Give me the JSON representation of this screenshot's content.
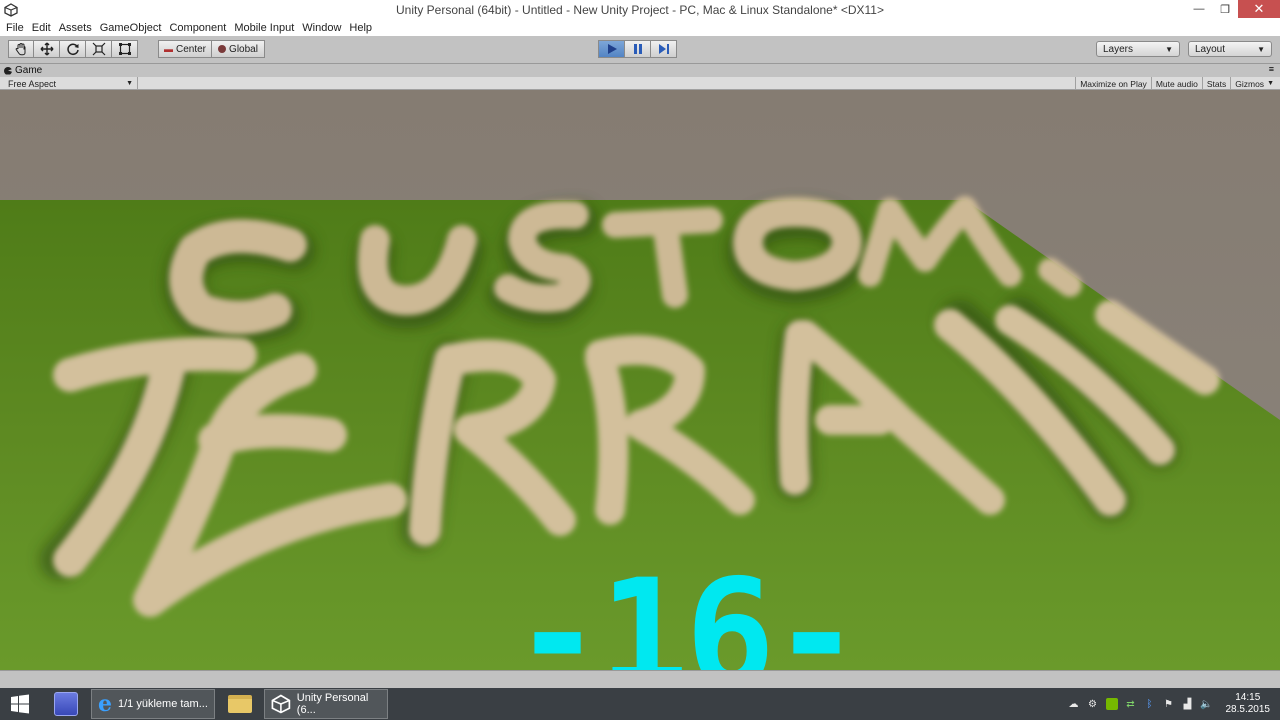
{
  "window": {
    "title": "Unity Personal (64bit) - Untitled - New Unity Project - PC, Mac & Linux Standalone* <DX11>",
    "minimize_glyph": "—",
    "maximize_glyph": "❐",
    "close_glyph": "✕"
  },
  "menu": [
    "File",
    "Edit",
    "Assets",
    "GameObject",
    "Component",
    "Mobile Input",
    "Window",
    "Help"
  ],
  "toolbar": {
    "tools": [
      "hand-icon",
      "move-icon",
      "rotate-icon",
      "scale-icon",
      "rect-icon"
    ],
    "pivot_label": "Center",
    "space_label": "Global",
    "play_state": "playing",
    "layers_label": "Layers",
    "layout_label": "Layout"
  },
  "game_tab": {
    "label": "Game",
    "aspect": "Free Aspect",
    "options": [
      "Maximize on Play",
      "Mute audio",
      "Stats",
      "Gizmos"
    ]
  },
  "scene": {
    "overlay_text": "-16-",
    "overlay_color": "#00e8f0",
    "terrain_color": "#5e8a22",
    "sand_color": "#cdb995"
  },
  "taskbar": {
    "items": [
      {
        "label": "1/1 yükleme tam..."
      },
      {
        "label": ""
      },
      {
        "label": "Unity Personal (6..."
      }
    ],
    "time": "14:15",
    "date": "28.5.2015"
  }
}
